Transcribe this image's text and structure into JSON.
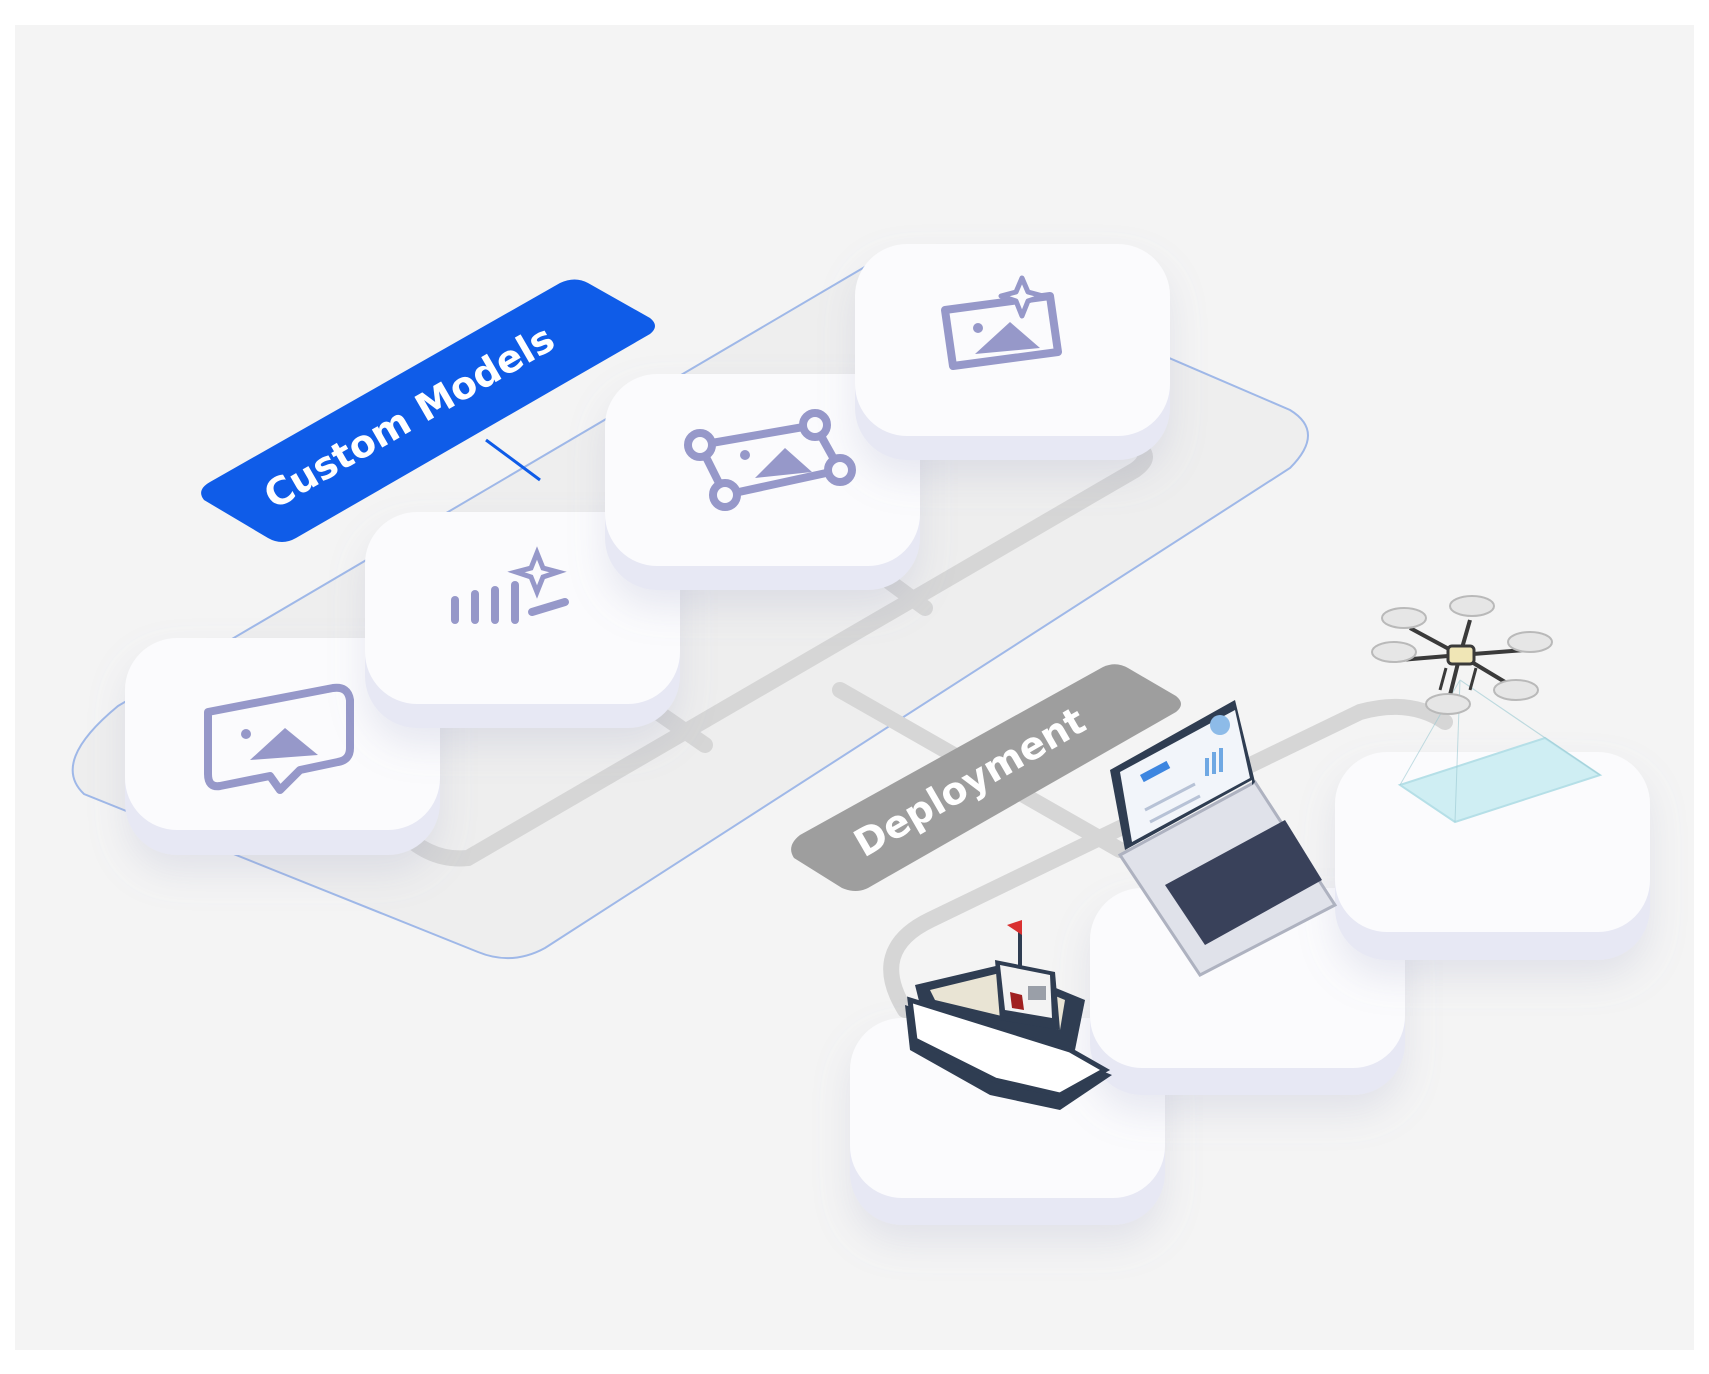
{
  "diagram": {
    "labels": {
      "custom_models": "Custom Models",
      "deployment": "Deployment"
    },
    "model_icons": [
      "image-caption-icon",
      "text-generation-icon",
      "object-detection-icon",
      "image-generation-icon"
    ],
    "deployment_targets": [
      "boat",
      "laptop",
      "drone"
    ],
    "colors": {
      "background": "#f4f4f4",
      "accent_blue": "#0f5ce8",
      "label_gray": "#9e9e9e",
      "icon_purple": "#9698c9",
      "tile_white": "#fbfbfd",
      "tile_side": "#e7e8f4",
      "outline_blue": "#9fb8e8",
      "connector_gray": "#d6d6d6"
    }
  }
}
